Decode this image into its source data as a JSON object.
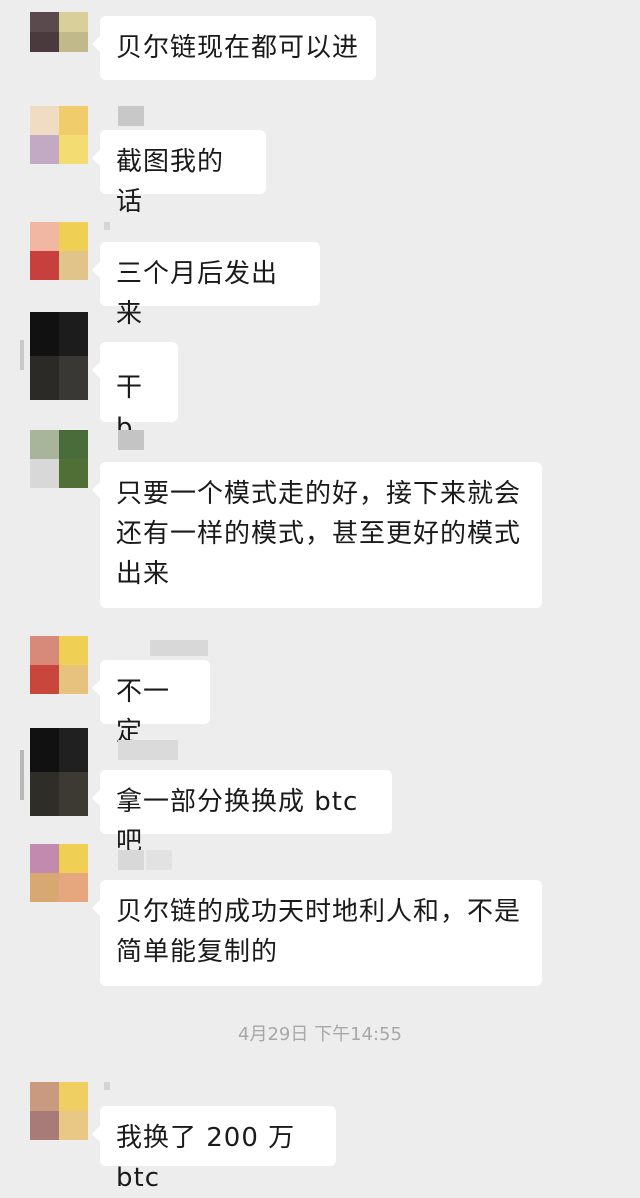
{
  "messages": [
    {
      "text": "贝尔链现在都可以进",
      "avatar": [
        "#5a4a4e",
        "#d8cf9a",
        "#4a3a3e",
        "#c2b98a"
      ],
      "sender": [
        "#bdbdbd"
      ]
    },
    {
      "text": "截图我的话",
      "avatar": [
        "#f0dcc2",
        "#f0cd6a",
        "#c2a9c4",
        "#f3dc72"
      ],
      "sender": [
        "#c8c8c8"
      ]
    },
    {
      "text": "三个月后发出来",
      "avatar": [
        "#f2b7a2",
        "#f0cf55",
        "#c8403e",
        "#e0c48a"
      ],
      "sender": [
        "#d6d6d6"
      ]
    },
    {
      "text": "干 b",
      "avatar": [
        "#111111",
        "#1c1c1c",
        "#2c2a26",
        "#3a3834"
      ],
      "sender": [
        "#dcdcdc"
      ]
    },
    {
      "text": "只要一个模式走的好，接下来就会还有一样的模式，甚至更好的模式出来",
      "avatar": [
        "#a9b59a",
        "#4a6b3a",
        "#d8d8d8",
        "#4f6f36"
      ],
      "sender": [
        "#c4c4c4"
      ]
    },
    {
      "text": "不一定",
      "avatar": [
        "#d88a7a",
        "#f0cf55",
        "#c9463c",
        "#e6c27e"
      ],
      "sender": [
        "#d8d8d8"
      ]
    },
    {
      "text": "拿一部分换换成 btc 吧",
      "avatar": [
        "#111111",
        "#202020",
        "#2f2d28",
        "#3d3a34"
      ],
      "sender": [
        "#dadada"
      ]
    },
    {
      "text": "贝尔链的成功天时地利人和，不是简单能复制的",
      "avatar": [
        "#c28aae",
        "#f0cf55",
        "#d8a872",
        "#e6a67e"
      ],
      "sender": [
        "#d8d8d8",
        "#e2e2e2"
      ]
    },
    {
      "text": "我换了 200 万 btc",
      "avatar": [
        "#c99a80",
        "#efcf62",
        "#a87a78",
        "#e8c884"
      ],
      "sender": [
        "#d4d4d4"
      ]
    }
  ],
  "timestamp": "4月29日 下午14:55"
}
